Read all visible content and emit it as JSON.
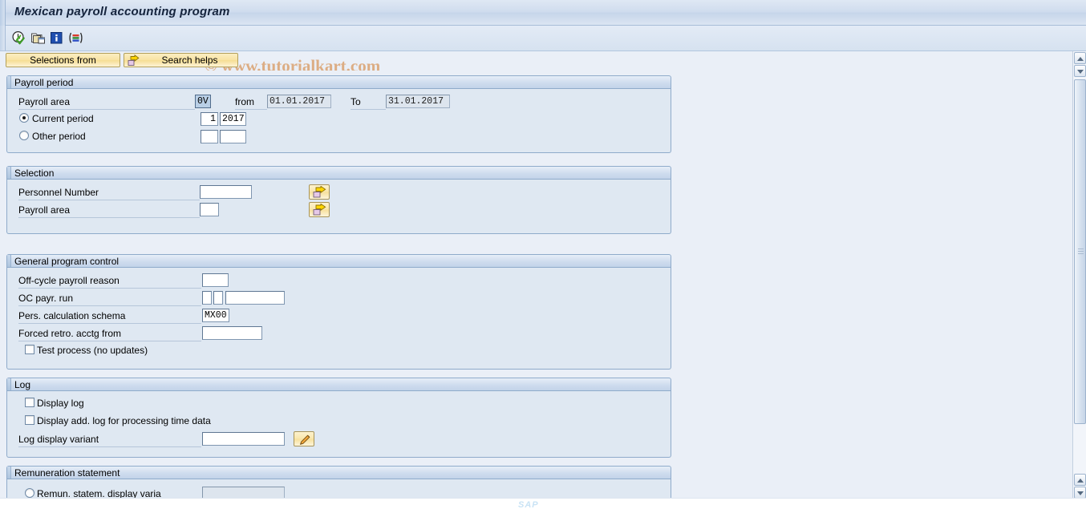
{
  "window": {
    "title": "Mexican payroll accounting program",
    "watermark": "© www.tutorialkart.com"
  },
  "toolbar": {
    "icons": [
      {
        "name": "execute-icon",
        "title": "Execute"
      },
      {
        "name": "get-variant-icon",
        "title": "Get Variant"
      },
      {
        "name": "info-icon",
        "title": "Information"
      },
      {
        "name": "selection-bars-icon",
        "title": "Selection screen help"
      }
    ]
  },
  "buttons": {
    "selections_from": "Selections from",
    "search_helps": "Search helps"
  },
  "sections": {
    "payroll_period": {
      "title": "Payroll period",
      "payroll_area_label": "Payroll area",
      "payroll_area_value": "0V",
      "from_label": "from",
      "from_value": "01.01.2017",
      "to_label": "To",
      "to_value": "31.01.2017",
      "current_period_label": "Current period",
      "current_period_selected": true,
      "current_period_num": "1",
      "current_period_year": "2017",
      "other_period_label": "Other period",
      "other_period_num": "",
      "other_period_year": ""
    },
    "selection": {
      "title": "Selection",
      "personnel_number_label": "Personnel Number",
      "personnel_number_value": "",
      "payroll_area_label": "Payroll area",
      "payroll_area_value": "",
      "multi_select_icon": "multiple-selection-icon"
    },
    "general_program_control": {
      "title": "General program control",
      "off_cycle_reason_label": "Off-cycle payroll reason",
      "off_cycle_reason_value": "",
      "oc_payr_run_label": "OC payr. run",
      "oc_payr_run_value_1": "",
      "oc_payr_run_value_2": "",
      "oc_payr_run_value_3": "",
      "pers_calc_schema_label": "Pers. calculation schema",
      "pers_calc_schema_value": "MX00",
      "forced_retro_label": "Forced retro. acctg from",
      "forced_retro_value": "",
      "test_process_label": "Test process (no updates)",
      "test_process_checked": false
    },
    "log": {
      "title": "Log",
      "display_log_label": "Display log",
      "display_log_checked": false,
      "display_add_log_label": "Display add. log for processing time data",
      "display_add_log_checked": false,
      "log_display_variant_label": "Log display variant",
      "log_display_variant_value": "",
      "edit_icon": "pencil-icon"
    },
    "remuneration_statement": {
      "title": "Remuneration statement",
      "remun_variant_label": "Remun. statem. display varia",
      "remun_variant_value": "",
      "remun_variant_selected": false
    }
  },
  "statusbar": {
    "sap_logo": "SAP"
  },
  "colors": {
    "title_text": "#14233c",
    "panel_body": "#dfe8f2",
    "page_bg": "#eaeff7",
    "button_yellow": "#f8e3a3",
    "watermark": "#dcaa7e",
    "field_border": "#7f96b0",
    "selected_field": "#b9cfe6"
  }
}
